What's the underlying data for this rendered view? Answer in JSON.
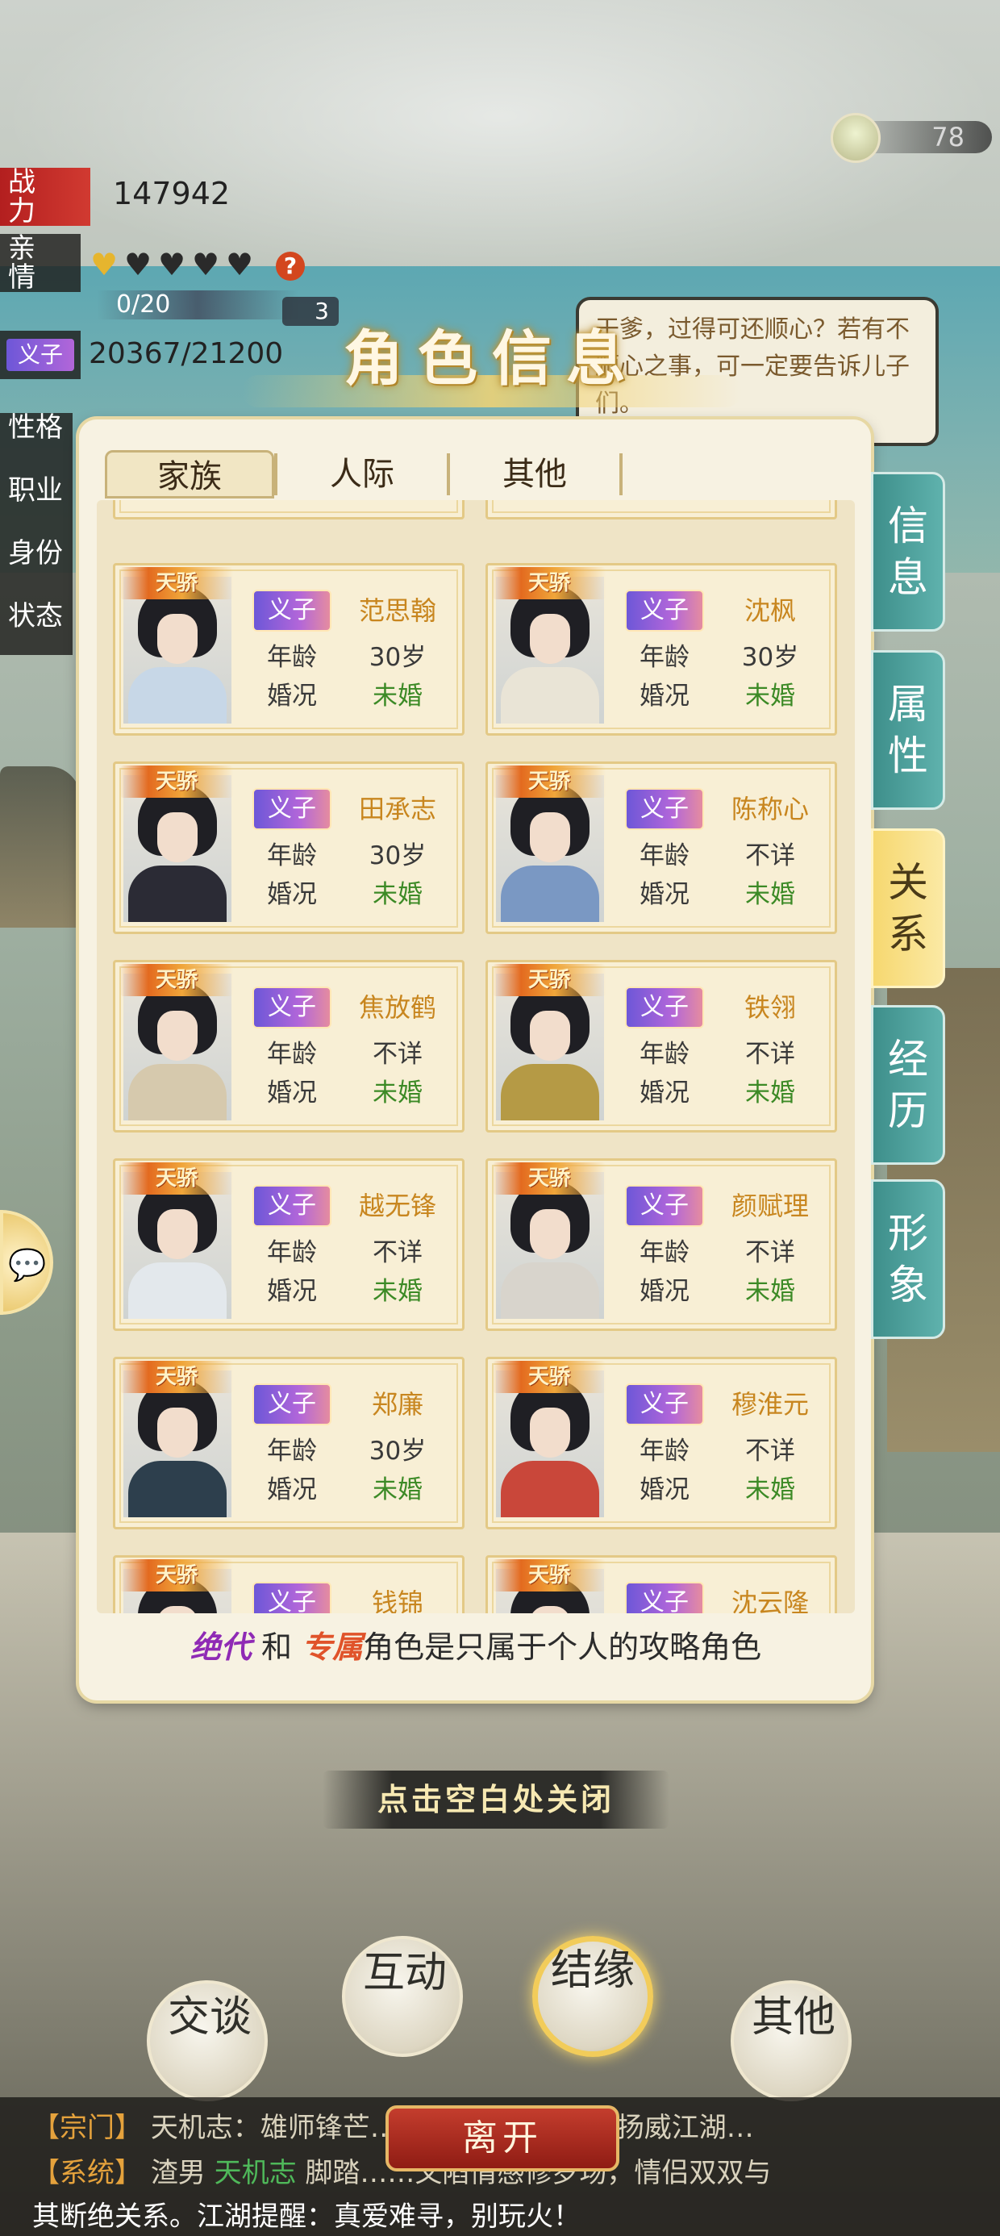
{
  "stats": {
    "combat_label": "战\n力",
    "combat_value": "147942",
    "affection_label": "亲\n情",
    "affection_hearts": [
      "gold",
      "black",
      "black",
      "black",
      "black"
    ],
    "affection_progress": "0/20",
    "small_count": "3",
    "relation_tag": "义子",
    "relation_value": "20367/21200",
    "side_labels": [
      "性格",
      "职业",
      "身份",
      "状态"
    ]
  },
  "resource": {
    "value": "78"
  },
  "speech_bubble": "干爹，过得可还顺心？若有不顺心之事，可一定要告诉儿子们。",
  "panel": {
    "title": "角色信息",
    "tabs": [
      "家族",
      "人际",
      "其他"
    ],
    "active_tab": "家族",
    "card_tag": "天骄",
    "age_label": "年龄",
    "marriage_label": "婚况",
    "cards": [
      {
        "role": "义子",
        "name": "范思翰",
        "age": "30岁",
        "marriage": "未婚",
        "body": "#c7d7e7"
      },
      {
        "role": "义子",
        "name": "沈枫",
        "age": "30岁",
        "marriage": "未婚",
        "body": "#e9e4d6"
      },
      {
        "role": "义子",
        "name": "田承志",
        "age": "30岁",
        "marriage": "未婚",
        "body": "#2b2b35"
      },
      {
        "role": "义子",
        "name": "陈称心",
        "age": "不详",
        "marriage": "未婚",
        "body": "#7a98c3"
      },
      {
        "role": "义子",
        "name": "焦放鹤",
        "age": "不详",
        "marriage": "未婚",
        "body": "#d6c9ad"
      },
      {
        "role": "义子",
        "name": "铁翎",
        "age": "不详",
        "marriage": "未婚",
        "body": "#b59a45"
      },
      {
        "role": "义子",
        "name": "越无锋",
        "age": "不详",
        "marriage": "未婚",
        "body": "#e3e8ec"
      },
      {
        "role": "义子",
        "name": "颜赋理",
        "age": "不详",
        "marriage": "未婚",
        "body": "#d8d4cc"
      },
      {
        "role": "义子",
        "name": "郑廉",
        "age": "30岁",
        "marriage": "未婚",
        "body": "#2d3f4d"
      },
      {
        "role": "义子",
        "name": "穆淮元",
        "age": "不详",
        "marriage": "未婚",
        "body": "#c9473a"
      },
      {
        "role": "义子",
        "name": "钱锦",
        "age": "",
        "marriage": "",
        "body": "#c8b88e"
      },
      {
        "role": "义子",
        "name": "沈云隆",
        "age": "",
        "marriage": "",
        "body": "#c8b88e"
      }
    ],
    "notice": {
      "jd": "绝代",
      "and": " 和 ",
      "zs": "专属",
      "rest": "角色是只属于个人的攻略角色"
    },
    "side_tabs": [
      "信\n息",
      "属\n性",
      "关\n系",
      "经\n历",
      "形\n象"
    ],
    "active_side_tab": "关系"
  },
  "close_hint": "点击空白处关闭",
  "actions": [
    "交谈",
    "互动",
    "结缘",
    "其他"
  ],
  "leave_button": "离开",
  "log": {
    "line1_tag": "【宗门】",
    "line1_text": "天机志：雄师锋芒……克强敌合欢宗，扬威江湖…",
    "line2_tag": "【系统】",
    "line2_pre": "渣男",
    "line2_hl": "天机志",
    "line2_text": "脚踏……又陷情感修罗场，情侣双双与",
    "line3_text": "其断绝关系。江湖提醒：真爱难寻，别玩火！"
  },
  "colors": {
    "accent_teal": "#3e8f8b",
    "gold": "#f2cc5a",
    "green_status": "#3c8a26",
    "name_orange": "#c8861f"
  }
}
